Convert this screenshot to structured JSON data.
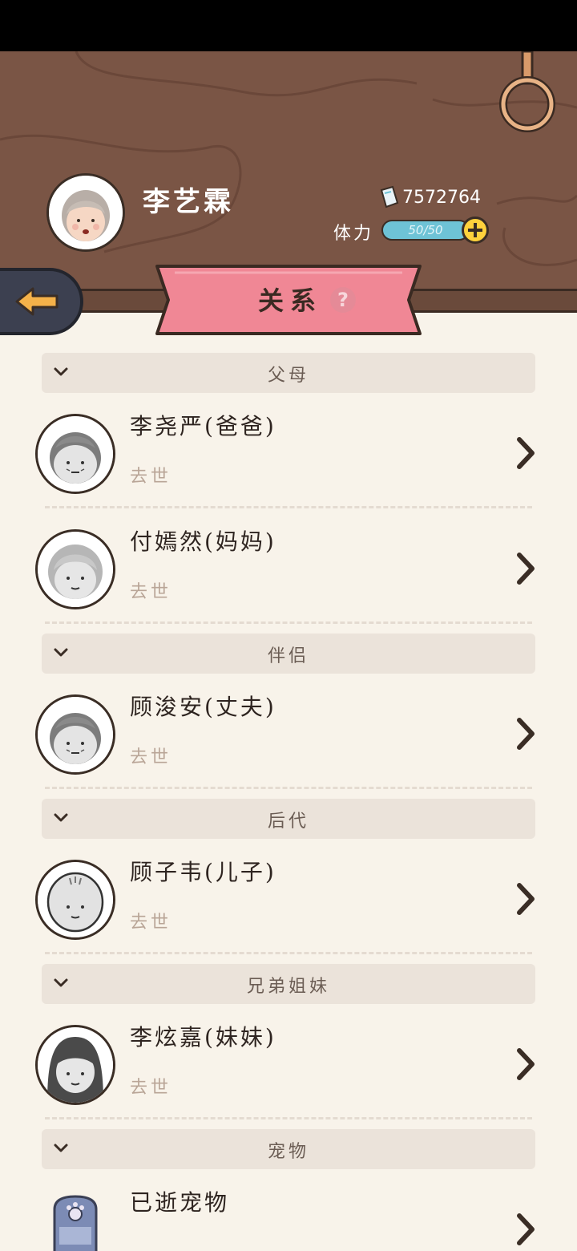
{
  "player": {
    "name": "李艺霖",
    "money": "7572764",
    "stamina_label": "体力",
    "stamina_text": "50/50",
    "stamina_fraction": 1.0
  },
  "header": {
    "title": "关系",
    "help": "?"
  },
  "sections": [
    {
      "label": "父母",
      "rows": [
        {
          "name": "李尧严(爸爸)",
          "status": "去世",
          "avatar": "old-man-face-icon"
        },
        {
          "name": "付嫣然(妈妈)",
          "status": "去世",
          "avatar": "old-woman-face-icon"
        }
      ]
    },
    {
      "label": "伴侣",
      "rows": [
        {
          "name": "顾浚安(丈夫)",
          "status": "去世",
          "avatar": "old-man-face-icon"
        }
      ]
    },
    {
      "label": "后代",
      "rows": [
        {
          "name": "顾子韦(儿子)",
          "status": "去世",
          "avatar": "bald-man-face-icon"
        }
      ]
    },
    {
      "label": "兄弟姐妹",
      "rows": [
        {
          "name": "李炫嘉(妹妹)",
          "status": "去世",
          "avatar": "woman-face-icon"
        }
      ]
    },
    {
      "label": "宠物",
      "rows": [
        {
          "name": "已逝宠物",
          "status": "",
          "avatar": "pet-tombstone-icon"
        }
      ]
    }
  ],
  "colors": {
    "header_bg": "#7a5545",
    "ribbon": "#f08795",
    "stamina": "#6ec3d6",
    "page_bg": "#f8f3ea"
  }
}
